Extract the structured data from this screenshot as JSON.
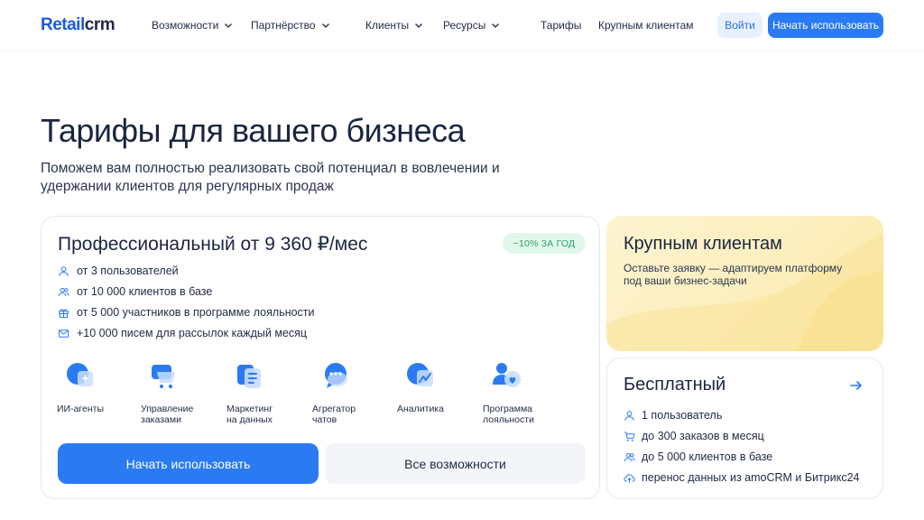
{
  "header": {
    "logo_retail": "Retail",
    "logo_crm": "crm",
    "nav": [
      {
        "label": "Возможности"
      },
      {
        "label": "Партнёрство"
      },
      {
        "label": "Клиенты"
      },
      {
        "label": "Ресурсы"
      },
      {
        "label": "Тарифы"
      },
      {
        "label": "Крупным клиентам"
      }
    ],
    "login_label": "Войти",
    "start_label": "Начать использовать"
  },
  "hero": {
    "title": "Тарифы для вашего бизнеса",
    "subtitle": "Поможем вам полностью реализовать свой потенциал в вовлечении и удержании клиентов для регулярных продаж"
  },
  "pro": {
    "title": "Профессиональный от 9 360 ₽/мес",
    "badge": "−10% ЗА ГОД",
    "features": [
      {
        "icon": "user-icon",
        "text": "от 3 пользователей"
      },
      {
        "icon": "users-icon",
        "text": "от 10 000 клиентов в базе"
      },
      {
        "icon": "gift-icon",
        "text": "от 5 000 участников в программе лояльности"
      },
      {
        "icon": "mail-icon",
        "text": "+10 000 писем для рассылок каждый месяц"
      }
    ],
    "modules": [
      {
        "icon": "ai-agent-icon",
        "label": "ИИ-агенты"
      },
      {
        "icon": "cart-icon",
        "label": "Управление\nзаказами"
      },
      {
        "icon": "data-marketing-icon",
        "label": "Маркетинг\nна данных"
      },
      {
        "icon": "chat-icon",
        "label": "Агрегатор\nчатов"
      },
      {
        "icon": "analytics-icon",
        "label": "Аналитика"
      },
      {
        "icon": "loyalty-icon",
        "label": "Программа\nлояльности"
      }
    ],
    "start_label": "Начать использовать",
    "all_label": "Все возможности"
  },
  "enterprise": {
    "title": "Крупным клиентам",
    "desc": "Оставьте заявку — адаптируем платформу под ваши бизнес-задачи"
  },
  "free": {
    "title": "Бесплатный",
    "features": [
      {
        "icon": "user-icon",
        "text": "1 пользователь"
      },
      {
        "icon": "cart-icon",
        "text": "до 300 заказов в месяц"
      },
      {
        "icon": "users-icon",
        "text": "до 5 000 клиентов в базе"
      },
      {
        "icon": "cloud-upload-icon",
        "text": "перенос данных из amoCRM и Битрикс24"
      }
    ]
  },
  "colors": {
    "accent": "#2a7bf2",
    "badge_bg": "#e2f7ec",
    "badge_text": "#2fa464",
    "enterprise_bg": "#fcefbf"
  }
}
